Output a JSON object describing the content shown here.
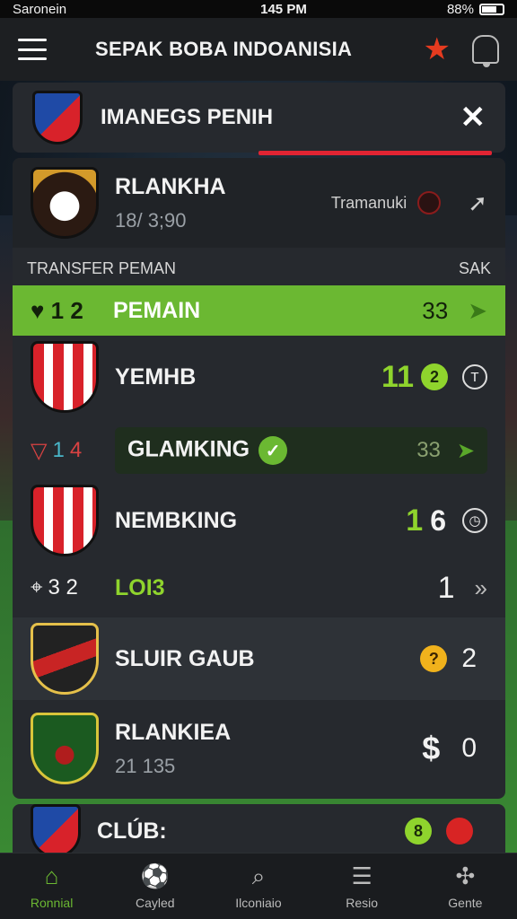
{
  "status_bar": {
    "carrier": "Saronein",
    "time": "145 PM",
    "battery": "88%"
  },
  "app_bar": {
    "title": "SEPAK BOBA INDOANISIA"
  },
  "search_card": {
    "title": "IMANEGS PENIH"
  },
  "top_club": {
    "name": "RLANKHA",
    "sub": "18/ 3;90",
    "tag": "Tramanuki"
  },
  "section": {
    "left": "TRANSFER PEMAN",
    "right": "SAK"
  },
  "highlight_row": {
    "rank": "1 2",
    "name": "PEMAIN",
    "value": "33"
  },
  "rows": [
    {
      "name": "YEMHB",
      "value": "11",
      "dot": "2"
    },
    {
      "rank_a": "1",
      "rank_b": "4",
      "name": "GLAMKING",
      "value": "33"
    },
    {
      "name": "NEMBKING",
      "value": "1",
      "extra": "6"
    },
    {
      "rank": "3 2",
      "name": "LOI3",
      "value": "1"
    },
    {
      "name": "SLUIR GAUB",
      "dot": "?",
      "value": "2"
    },
    {
      "name": "RLANKIEA",
      "sub": "21 135",
      "value": "$",
      "extra": "0"
    }
  ],
  "club_row": {
    "name": "CLÚB:",
    "dot": "8"
  },
  "bottom_nav": [
    {
      "label": "Ronnial",
      "icon": "home-icon"
    },
    {
      "label": "Cayled",
      "icon": "ball-icon"
    },
    {
      "label": "Ilconiaio",
      "icon": "search-icon"
    },
    {
      "label": "Resio",
      "icon": "list-icon"
    },
    {
      "label": "Gente",
      "icon": "team-icon"
    }
  ]
}
